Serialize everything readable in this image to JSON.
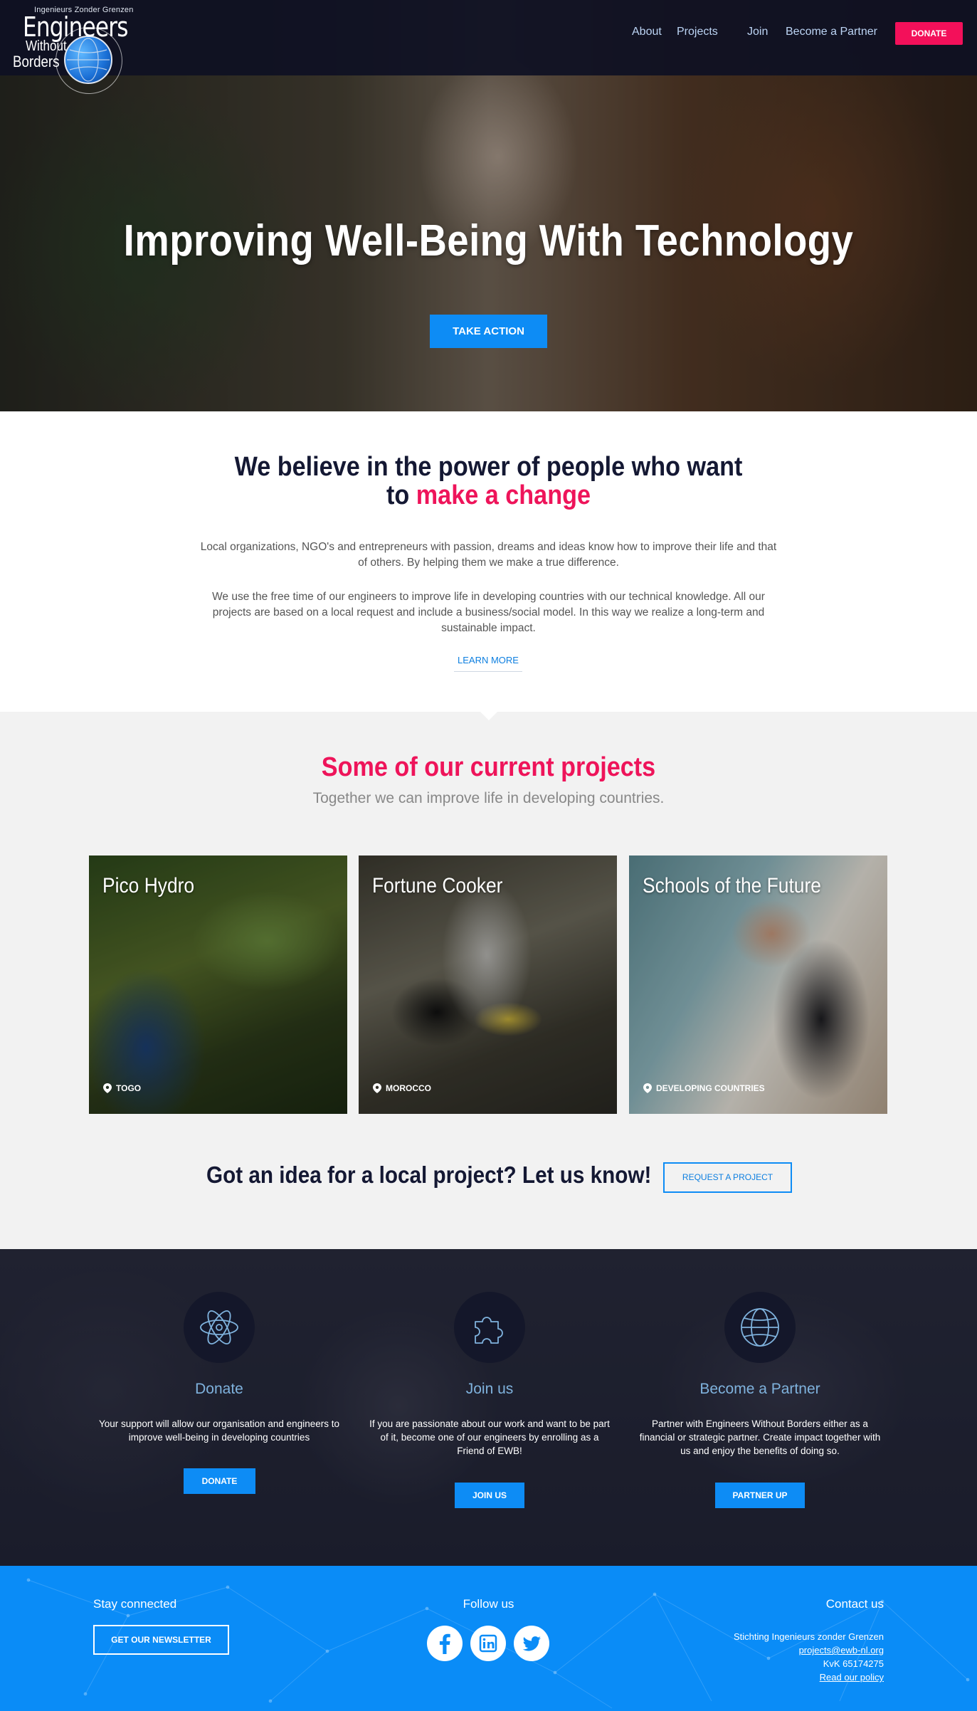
{
  "logo": {
    "small": "Ingenieurs Zonder Grenzen",
    "line1": "Engineers",
    "line2": "Without",
    "line3": "Borders"
  },
  "nav": {
    "about": "About",
    "projects": "Projects",
    "join": "Join",
    "partner": "Become a Partner",
    "donate": "DONATE"
  },
  "hero": {
    "title": "Improving Well-Being With Technology",
    "cta": "TAKE ACTION"
  },
  "believe": {
    "heading_line1": "We believe in the power of people who want",
    "heading_to": "to",
    "heading_accent": "make a change",
    "para1": "Local organizations, NGO's and entrepreneurs with passion, dreams and ideas know how to improve their life and that of others. By helping them we make a true difference.",
    "para2": "We use the free time of our engineers to improve life in developing countries with our technical knowledge. All our projects are based on a local request and include a business/social model. In this way we realize a long-term and sustainable impact.",
    "learn_more": "LEARN MORE"
  },
  "projects": {
    "heading": "Some of our current projects",
    "subheading": "Together we can improve life in developing countries.",
    "cards": [
      {
        "title": "Pico Hydro",
        "location": "TOGO"
      },
      {
        "title": "Fortune Cooker",
        "location": "MOROCCO"
      },
      {
        "title": "Schools of the Future",
        "location": "DEVELOPING COUNTRIES"
      }
    ],
    "idea": "Got an idea for a local project? Let us know!",
    "request_button": "REQUEST A PROJECT"
  },
  "cta": {
    "columns": [
      {
        "icon": "atom-icon",
        "title": "Donate",
        "text": "Your support will allow our organisation and engineers to improve well-being in developing countries",
        "button": "DONATE"
      },
      {
        "icon": "puzzle-icon",
        "title": "Join us",
        "text": "If you are passionate about our work and want to be part of it, become one of our engineers by enrolling as a Friend of EWB!",
        "button": "JOIN US"
      },
      {
        "icon": "globe-icon",
        "title": "Become a Partner",
        "text": "Partner with Engineers Without Borders either as a financial or strategic partner. Create impact together with us and enjoy the benefits of doing so.",
        "button": "PARTNER UP"
      }
    ]
  },
  "footer": {
    "stay_connected": "Stay connected",
    "newsletter": "GET OUR NEWSLETTER",
    "follow_us": "Follow us",
    "contact_us": "Contact us",
    "org": "Stichting Ingenieurs zonder Grenzen",
    "email": "projects@ewb-nl.org",
    "kvk": "KvK 65174275",
    "policy": "Read our policy"
  },
  "colors": {
    "accent_pink": "#ee145a",
    "primary_blue": "#0d8cf5",
    "navy": "#141833"
  }
}
